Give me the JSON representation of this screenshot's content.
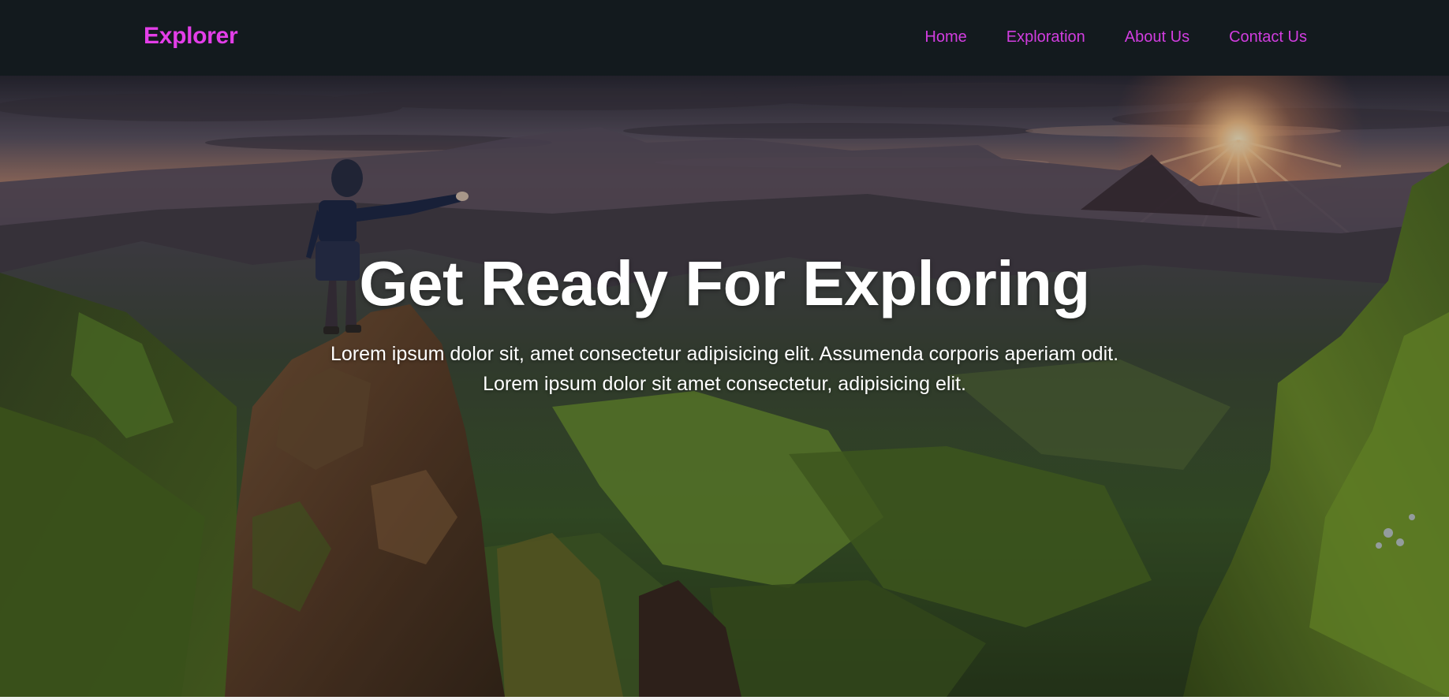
{
  "navbar": {
    "brand": "Explorer",
    "links": [
      {
        "label": "Home"
      },
      {
        "label": "Exploration"
      },
      {
        "label": "About Us"
      },
      {
        "label": "Contact Us"
      }
    ]
  },
  "hero": {
    "title": "Get Ready For Exploring",
    "subtitle_line1": "Lorem ipsum dolor sit, amet consectetur adipisicing elit. Assumenda corporis aperiam odit.",
    "subtitle_line2": "Lorem ipsum dolor sit amet consectetur, adipisicing elit."
  },
  "colors": {
    "navbar_bg": "#131a1e",
    "brand": "#e33ee8",
    "nav_link": "#d23de0",
    "hero_text": "#ffffff"
  }
}
